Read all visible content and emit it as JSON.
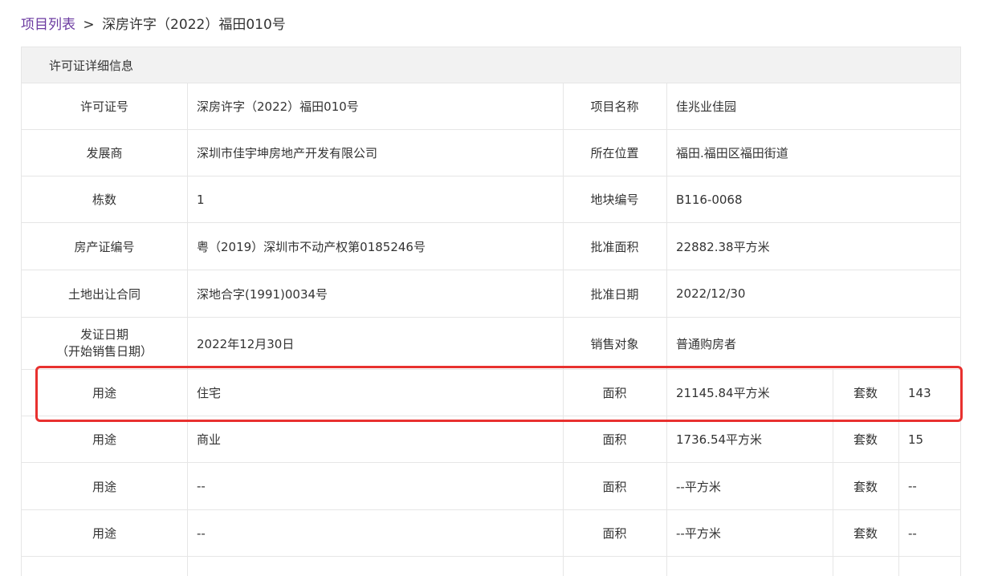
{
  "breadcrumb": {
    "link": "项目列表",
    "separator": ">",
    "current": "深房许字（2022）福田010号"
  },
  "panel": {
    "header": "许可证详细信息"
  },
  "details": [
    {
      "label1": "许可证号",
      "value1": "深房许字（2022）福田010号",
      "label2": "项目名称",
      "value2": "佳兆业佳园"
    },
    {
      "label1": "发展商",
      "value1": "深圳市佳宇坤房地产开发有限公司",
      "label2": "所在位置",
      "value2": "福田.福田区福田街道"
    },
    {
      "label1": "栋数",
      "value1": "1",
      "label2": "地块编号",
      "value2": "B116-0068"
    },
    {
      "label1": "房产证编号",
      "value1": "粤（2019）深圳市不动产权第0185246号",
      "label2": "批准面积",
      "value2": "22882.38平方米"
    },
    {
      "label1": "土地出让合同",
      "value1": "深地合字(1991)0034号",
      "label2": "批准日期",
      "value2": "2022/12/30"
    },
    {
      "label1a": "发证日期",
      "label1b": "（开始销售日期）",
      "value1": "2022年12月30日",
      "label2": "销售对象",
      "value2": "普通购房者"
    }
  ],
  "usage_rows": [
    {
      "use_label": "用途",
      "use_value": "住宅",
      "area_label": "面积",
      "area_value": "21145.84平方米",
      "units_label": "套数",
      "units_value": "143"
    },
    {
      "use_label": "用途",
      "use_value": "商业",
      "area_label": "面积",
      "area_value": "1736.54平方米",
      "units_label": "套数",
      "units_value": "15"
    },
    {
      "use_label": "用途",
      "use_value": "--",
      "area_label": "面积",
      "area_value": "--平方米",
      "units_label": "套数",
      "units_value": "--"
    },
    {
      "use_label": "用途",
      "use_value": "--",
      "area_label": "面积",
      "area_value": "--平方米",
      "units_label": "套数",
      "units_value": "--"
    }
  ],
  "colors": {
    "highlight": "#e8312f",
    "link": "#6b3aa0",
    "header_bg": "#f2f2f2"
  }
}
